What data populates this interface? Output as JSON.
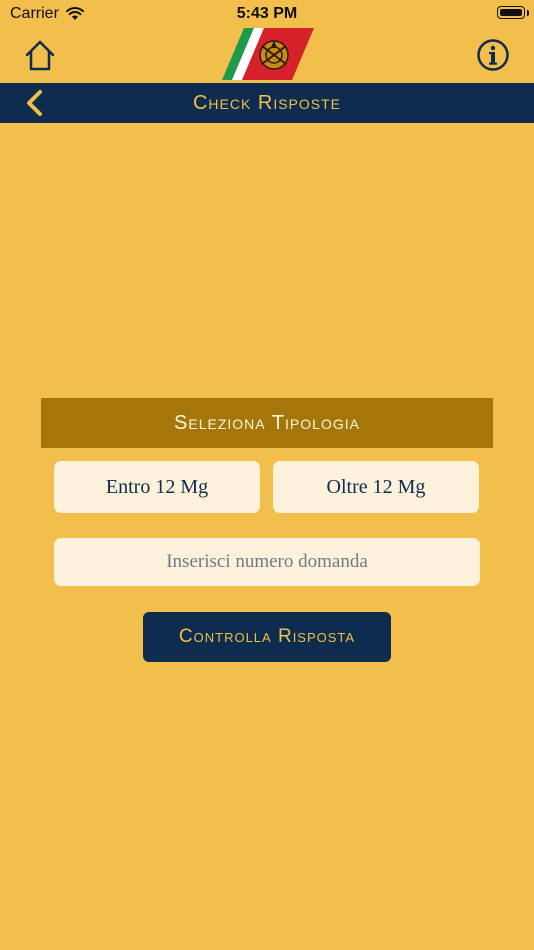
{
  "status_bar": {
    "carrier": "Carrier",
    "time": "5:43 PM"
  },
  "header": {
    "home_icon": "home-icon",
    "logo": "coast-guard-logo",
    "info_icon": "info-icon"
  },
  "nav": {
    "title": "Check Risposte",
    "back_icon": "chevron-left-icon"
  },
  "main": {
    "section_title": "Seleziona Tipologia",
    "options": [
      "Entro 12 Mg",
      "Oltre 12 Mg"
    ],
    "question_input": {
      "value": "",
      "placeholder": "Inserisci numero domanda"
    },
    "check_button": "Controlla Risposta"
  },
  "colors": {
    "background": "#F2BE4C",
    "navy": "#0E2D4E",
    "header_band": "#A5770A",
    "button_fill": "#FCF2DC"
  }
}
